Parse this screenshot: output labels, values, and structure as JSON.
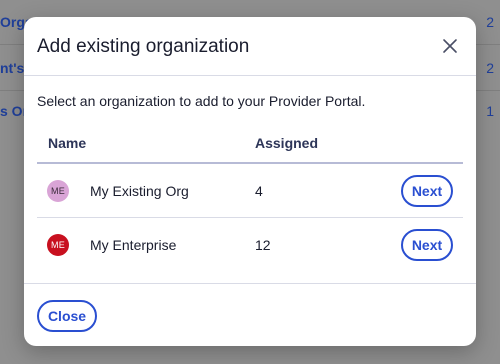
{
  "background": {
    "rows": [
      {
        "left": "Orga",
        "right": "2"
      },
      {
        "left": "nt's",
        "right": "2"
      },
      {
        "left": "s Or",
        "right": "1"
      }
    ]
  },
  "modal": {
    "title": "Add existing organization",
    "close_icon": "close-icon",
    "subtitle": "Select an organization to add to your Provider Portal.",
    "columns": {
      "name": "Name",
      "assigned": "Assigned"
    },
    "rows": [
      {
        "initials": "ME",
        "avatar_bg": "#d9a4d6",
        "avatar_fg": "#3a2a3a",
        "name": "My Existing Org",
        "assigned": "4",
        "action": "Next"
      },
      {
        "initials": "ME",
        "avatar_bg": "#c8101f",
        "avatar_fg": "#ffffff",
        "name": "My Enterprise",
        "assigned": "12",
        "action": "Next"
      }
    ],
    "close_label": "Close"
  },
  "colors": {
    "accent": "#2a4fd1",
    "overlay": "#8f8f8f"
  }
}
